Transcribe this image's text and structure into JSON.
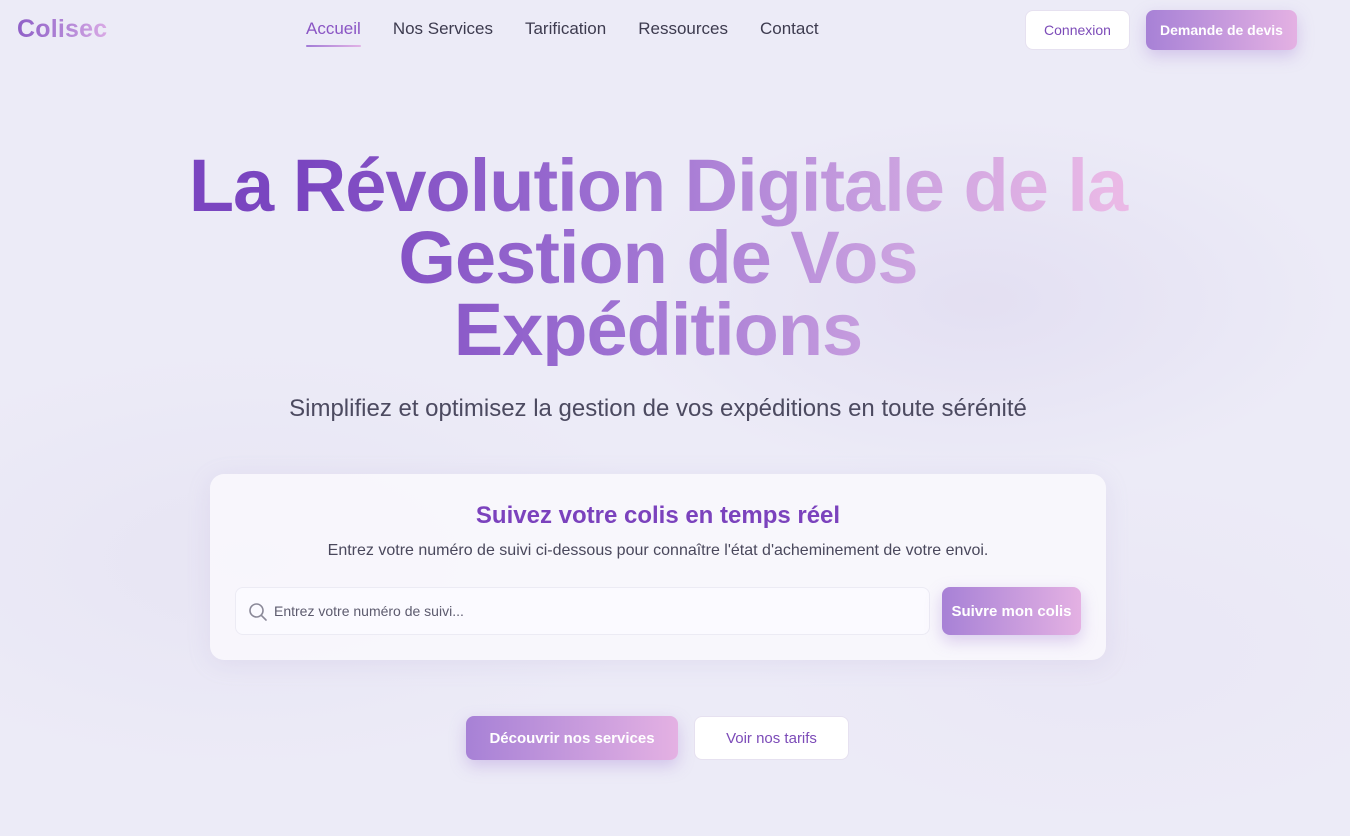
{
  "header": {
    "logo": "Colisec",
    "nav": [
      {
        "label": "Accueil",
        "active": true
      },
      {
        "label": "Nos Services",
        "active": false
      },
      {
        "label": "Tarification",
        "active": false
      },
      {
        "label": "Ressources",
        "active": false
      },
      {
        "label": "Contact",
        "active": false
      }
    ],
    "login_label": "Connexion",
    "quote_label": "Demande de devis"
  },
  "hero": {
    "title_lines": [
      "La Révolution Digitale de la",
      "Gestion de Vos",
      "Expéditions"
    ],
    "subtitle": "Simplifiez et optimisez la gestion de vos expéditions en toute sérénité"
  },
  "tracking": {
    "title": "Suivez votre colis en temps réel",
    "description": "Entrez votre numéro de suivi ci-dessous pour connaître l'état d'acheminement de votre envoi.",
    "placeholder": "Entrez votre numéro de suivi...",
    "value": "",
    "button_label": "Suivre mon colis",
    "icon": "search-icon"
  },
  "cta": {
    "services_label": "Découvrir nos services",
    "pricing_label": "Voir nos tarifs"
  },
  "colors": {
    "accent": "#7b42bd",
    "gradient_start": "#a781d6",
    "gradient_end": "#e4b1e3",
    "background": "#ecebf7"
  }
}
